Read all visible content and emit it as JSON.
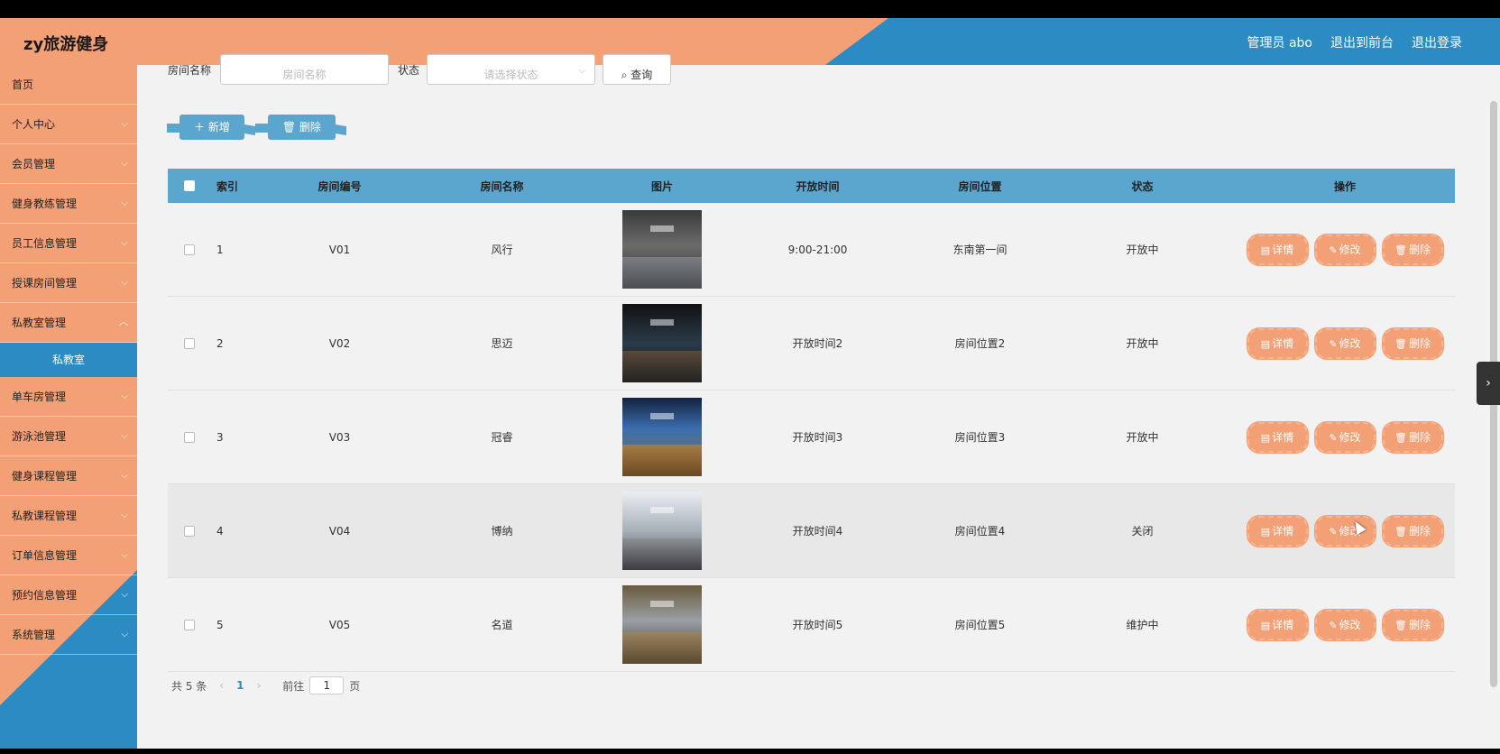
{
  "header": {
    "brand": "zy旅游健身",
    "admin": "管理员 abo",
    "to_front": "退出到前台",
    "logout": "退出登录"
  },
  "sidebar": {
    "items": [
      {
        "label": "首页"
      },
      {
        "label": "个人中心"
      },
      {
        "label": "会员管理"
      },
      {
        "label": "健身教练管理"
      },
      {
        "label": "员工信息管理"
      },
      {
        "label": "授课房间管理"
      },
      {
        "label": "私教室管理"
      },
      {
        "label": "私教室"
      },
      {
        "label": "单车房管理"
      },
      {
        "label": "游泳池管理"
      },
      {
        "label": "健身课程管理"
      },
      {
        "label": "私教课程管理"
      },
      {
        "label": "订单信息管理"
      },
      {
        "label": "预约信息管理"
      },
      {
        "label": "系统管理"
      }
    ],
    "chevron": "⌵"
  },
  "search": {
    "room_label": "房间名称",
    "room_placeholder": "房间名称",
    "status_label": "状态",
    "status_placeholder": "请选择状态",
    "query_label": "查询",
    "query_icon": "⌕"
  },
  "actions": {
    "add_label": "新增",
    "delete_label": "删除"
  },
  "table": {
    "headers": [
      "索引",
      "房间编号",
      "房间名称",
      "图片",
      "开放时间",
      "房间位置",
      "状态",
      "操作"
    ],
    "rows": [
      {
        "idx": "1",
        "code": "V01",
        "name": "风行",
        "time": "9:00-21:00",
        "pos": "东南第一间",
        "status": "开放中"
      },
      {
        "idx": "2",
        "code": "V02",
        "name": "思迈",
        "time": "开放时间2",
        "pos": "房间位置2",
        "status": "开放中"
      },
      {
        "idx": "3",
        "code": "V03",
        "name": "冠睿",
        "time": "开放时间3",
        "pos": "房间位置3",
        "status": "开放中"
      },
      {
        "idx": "4",
        "code": "V04",
        "name": "博纳",
        "time": "开放时间4",
        "pos": "房间位置4",
        "status": "关闭"
      },
      {
        "idx": "5",
        "code": "V05",
        "name": "名道",
        "time": "开放时间5",
        "pos": "房间位置5",
        "status": "维护中"
      }
    ],
    "op_detail": "详情",
    "op_edit": "修改",
    "op_delete": "删除"
  },
  "pager": {
    "total": "共 5 条",
    "current": "1",
    "goto_label": "前往",
    "goto_value": "1",
    "page_unit": "页"
  },
  "colors": {
    "orange": "#f4a076",
    "blue": "#2b8bc2",
    "table_head": "#5ba6cf"
  }
}
